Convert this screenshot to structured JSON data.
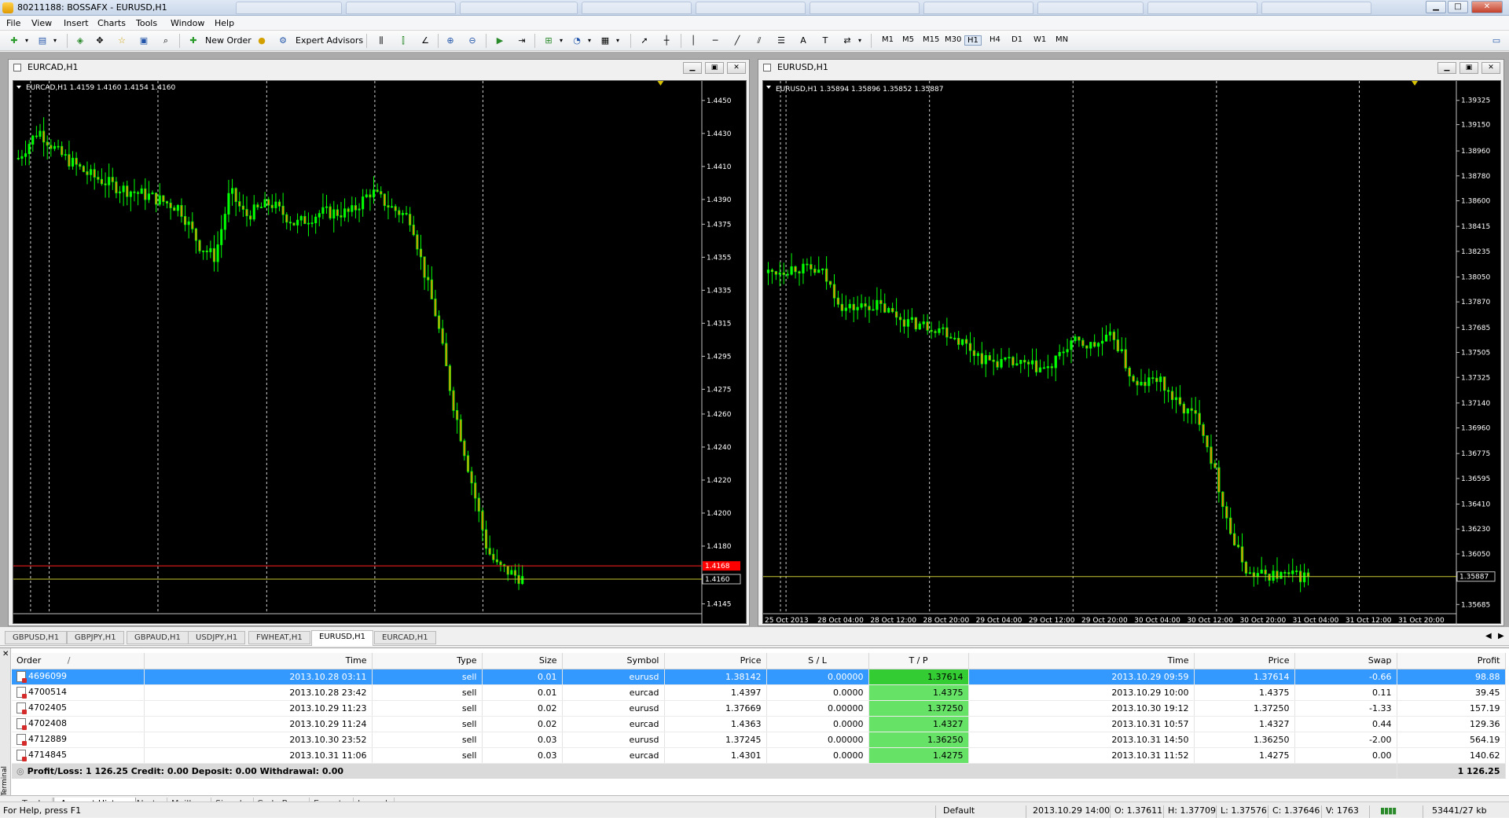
{
  "window": {
    "title": "80211188: BOSSAFX - EURUSD,H1"
  },
  "menu": [
    "File",
    "View",
    "Insert",
    "Charts",
    "Tools",
    "Window",
    "Help"
  ],
  "toolbar": {
    "new_order": "New Order",
    "expert_advisors": "Expert Advisors",
    "timeframes": [
      "M1",
      "M5",
      "M15",
      "M30",
      "H1",
      "H4",
      "D1",
      "W1",
      "MN"
    ],
    "active_timeframe": "H1"
  },
  "charts": [
    {
      "window_title": "EURCAD,H1",
      "symbol_line": "EURCAD,H1  1.4159 1.4160 1.4154 1.4160",
      "price_labels": [
        "1.4450",
        "1.4430",
        "1.4410",
        "1.4390",
        "1.4375",
        "1.4355",
        "1.4335",
        "1.4315",
        "1.4295",
        "1.4275",
        "1.4260",
        "1.4240",
        "1.4220",
        "1.4200",
        "1.4180",
        "1.4160",
        "1.4145"
      ],
      "ask_price": "1.4168",
      "bid_price": "1.4160",
      "time_labels": [],
      "chart_data": {
        "type": "candlestick",
        "symbol": "EURCAD",
        "timeframe": "H1",
        "ylim": [
          1.414,
          1.4458
        ],
        "last_close": 1.416,
        "ask": 1.4168,
        "grid": false,
        "bull_color": "#00ff00",
        "bear_color": "#ff8000",
        "background": "#000000"
      }
    },
    {
      "window_title": "EURUSD,H1",
      "symbol_line": "EURUSD,H1  1.35894 1.35896 1.35852 1.35887",
      "price_labels": [
        "1.39325",
        "1.39150",
        "1.38960",
        "1.38780",
        "1.38600",
        "1.38415",
        "1.38235",
        "1.38050",
        "1.37870",
        "1.37685",
        "1.37505",
        "1.37325",
        "1.37140",
        "1.36960",
        "1.36775",
        "1.36595",
        "1.36410",
        "1.36230",
        "1.36050",
        "1.35887",
        "1.35685"
      ],
      "bid_price": "1.35887",
      "time_labels": [
        "25 Oct 2013",
        "28 Oct 04:00",
        "28 Oct 12:00",
        "28 Oct 20:00",
        "29 Oct 04:00",
        "29 Oct 12:00",
        "29 Oct 20:00",
        "30 Oct 04:00",
        "30 Oct 12:00",
        "30 Oct 20:00",
        "31 Oct 04:00",
        "31 Oct 12:00",
        "31 Oct 20:00"
      ],
      "chart_data": {
        "type": "candlestick",
        "symbol": "EURUSD",
        "timeframe": "H1",
        "ylim": [
          1.3563,
          1.3942
        ],
        "last_close": 1.35887,
        "grid": false,
        "bull_color": "#00ff00",
        "bear_color": "#ff8000",
        "background": "#000000"
      }
    }
  ],
  "chart_tabs": [
    "GBPUSD,H1",
    "GBPJPY,H1",
    "GBPAUD,H1",
    "USDJPY,H1",
    "FWHEAT,H1",
    "EURUSD,H1",
    "EURCAD,H1"
  ],
  "active_chart_tab": "EURUSD,H1",
  "terminal": {
    "label": "Terminal",
    "columns": [
      "Order",
      "Time",
      "Type",
      "Size",
      "Symbol",
      "Price",
      "S / L",
      "T / P",
      "Time",
      "Price",
      "Swap",
      "Profit"
    ],
    "order_sort_mark": "/",
    "rows": [
      [
        "4696099",
        "2013.10.28 03:11",
        "sell",
        "0.01",
        "eurusd",
        "1.38142",
        "0.00000",
        "1.37614",
        "2013.10.29 09:59",
        "1.37614",
        "-0.66",
        "98.88"
      ],
      [
        "4700514",
        "2013.10.28 23:42",
        "sell",
        "0.01",
        "eurcad",
        "1.4397",
        "0.0000",
        "1.4375",
        "2013.10.29 10:00",
        "1.4375",
        "0.11",
        "39.45"
      ],
      [
        "4702405",
        "2013.10.29 11:23",
        "sell",
        "0.02",
        "eurusd",
        "1.37669",
        "0.00000",
        "1.37250",
        "2013.10.30 19:12",
        "1.37250",
        "-1.33",
        "157.19"
      ],
      [
        "4702408",
        "2013.10.29 11:24",
        "sell",
        "0.02",
        "eurcad",
        "1.4363",
        "0.0000",
        "1.4327",
        "2013.10.31 10:57",
        "1.4327",
        "0.44",
        "129.36"
      ],
      [
        "4712889",
        "2013.10.30 23:52",
        "sell",
        "0.03",
        "eurusd",
        "1.37245",
        "0.00000",
        "1.36250",
        "2013.10.31 14:50",
        "1.36250",
        "-2.00",
        "564.19"
      ],
      [
        "4714845",
        "2013.10.31 11:06",
        "sell",
        "0.03",
        "eurcad",
        "1.4301",
        "0.0000",
        "1.4275",
        "2013.10.31 11:52",
        "1.4275",
        "0.00",
        "140.62"
      ]
    ],
    "summary": {
      "text": "Profit/Loss: 1 126.25  Credit: 0.00  Deposit: 0.00  Withdrawal: 0.00",
      "total": "1 126.25"
    },
    "tabs": [
      "Trade",
      "Account History",
      "Alerts",
      "Mailbox",
      "Signals",
      "Code Base",
      "Experts",
      "Journal"
    ],
    "active_tab": "Account History"
  },
  "status": {
    "help": "For Help, press F1",
    "profile": "Default",
    "datetime": "2013.10.29 14:00",
    "open": "O: 1.37611",
    "high": "H: 1.37709",
    "low": "L: 1.37576",
    "close": "C: 1.37646",
    "volume": "V: 1763",
    "traffic": "53441/27 kb"
  }
}
